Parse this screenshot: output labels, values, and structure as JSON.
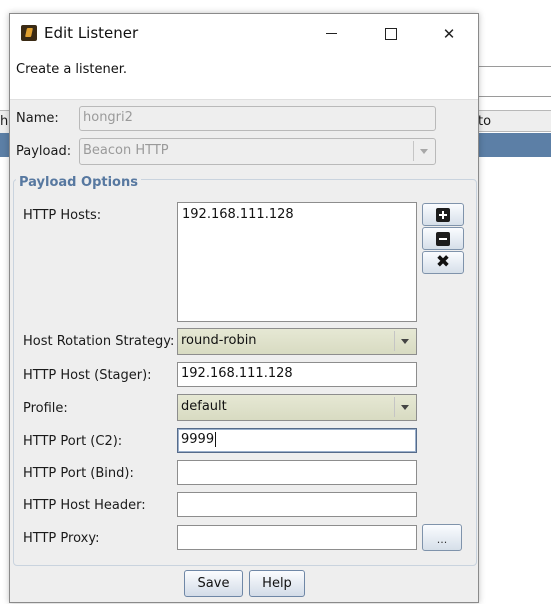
{
  "background": {
    "header_text": "to",
    "header_left_text": "h"
  },
  "dialog": {
    "title": "Edit Listener",
    "description": "Create a listener.",
    "window_controls": {
      "minimize_icon": "minimize-icon",
      "maximize_icon": "maximize-icon",
      "close_icon": "close-icon",
      "close_glyph": "✕"
    }
  },
  "form": {
    "name_label": "Name:",
    "name_value": "hongri2",
    "payload_label": "Payload:",
    "payload_value": "Beacon HTTP"
  },
  "payload_options": {
    "group_title": "Payload Options",
    "http_hosts_label": "HTTP Hosts:",
    "http_hosts": [
      "192.168.111.128"
    ],
    "add_icon": "plus-icon",
    "remove_icon": "minus-icon",
    "clear_icon": "x-icon",
    "clear_glyph": "✖",
    "rotation_label": "Host Rotation Strategy:",
    "rotation_value": "round-robin",
    "stager_label": "HTTP Host (Stager):",
    "stager_value": "192.168.111.128",
    "profile_label": "Profile:",
    "profile_value": "default",
    "port_c2_label": "HTTP Port (C2):",
    "port_c2_value": "9999",
    "port_bind_label": "HTTP Port (Bind):",
    "port_bind_value": "",
    "host_header_label": "HTTP Host Header:",
    "host_header_value": "",
    "proxy_label": "HTTP Proxy:",
    "proxy_value": "",
    "proxy_button_label": "..."
  },
  "buttons": {
    "save": "Save",
    "help": "Help"
  }
}
